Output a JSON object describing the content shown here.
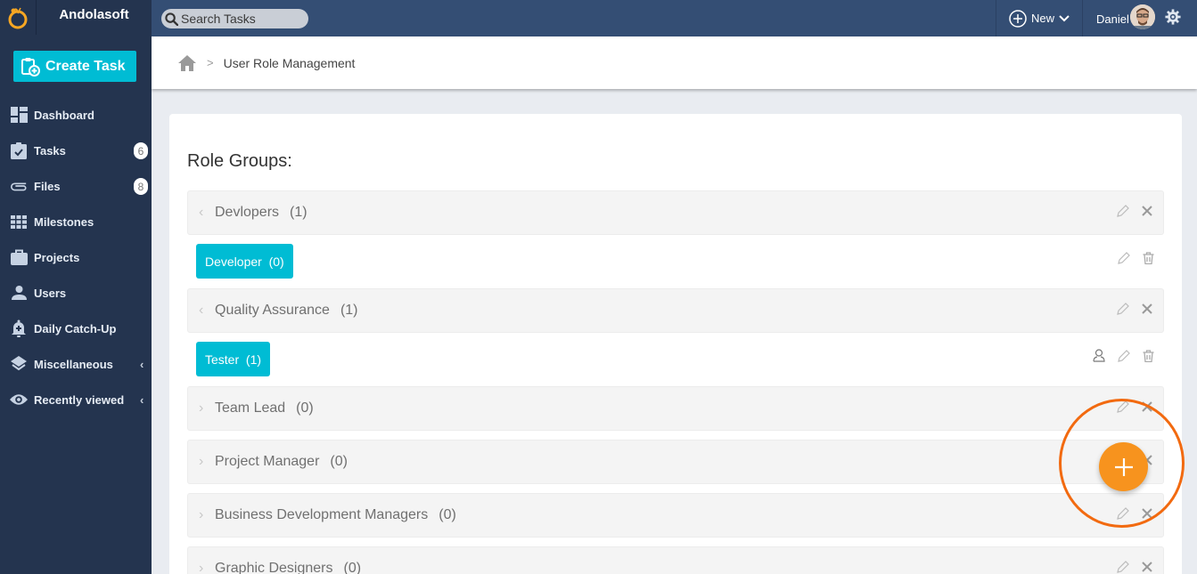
{
  "app": {
    "brand_name": "Andolasoft",
    "search_placeholder": "Search Tasks",
    "new_label": "New",
    "user_name": "Daniel"
  },
  "sidebar": {
    "create_task_label": "Create Task",
    "items": [
      {
        "label": "Dashboard",
        "icon": "dashboard-icon"
      },
      {
        "label": "Tasks",
        "icon": "tasks-icon",
        "badge": "6"
      },
      {
        "label": "Files",
        "icon": "paperclip-icon",
        "badge": "8"
      },
      {
        "label": "Milestones",
        "icon": "grid-icon"
      },
      {
        "label": "Projects",
        "icon": "briefcase-icon"
      },
      {
        "label": "Users",
        "icon": "user-icon"
      },
      {
        "label": "Daily Catch-Up",
        "icon": "bell-plus-icon"
      },
      {
        "label": "Miscellaneous",
        "icon": "layers-icon",
        "chevron": "‹"
      },
      {
        "label": "Recently viewed",
        "icon": "eye-icon",
        "chevron": "‹"
      }
    ]
  },
  "breadcrumb": {
    "separator": ">",
    "current": "User Role Management"
  },
  "main": {
    "title": "Role Groups:",
    "groups": [
      {
        "name": "Devlopers",
        "count": "(1)",
        "expanded": true,
        "roles": [
          {
            "name": "Developer",
            "count": "(0)",
            "has_user_icon": false
          }
        ]
      },
      {
        "name": "Quality Assurance",
        "count": "(1)",
        "expanded": true,
        "roles": [
          {
            "name": "Tester",
            "count": "(1)",
            "has_user_icon": true
          }
        ]
      },
      {
        "name": "Team Lead",
        "count": "(0)",
        "expanded": false
      },
      {
        "name": "Project Manager",
        "count": "(0)",
        "expanded": false
      },
      {
        "name": "Business Development Managers",
        "count": "(0)",
        "expanded": false
      },
      {
        "name": "Graphic Designers",
        "count": "(0)",
        "expanded": false
      }
    ]
  },
  "colors": {
    "accent": "#00bcd4",
    "fab": "#f7931e",
    "highlight": "#f26a10",
    "topbar": "#344e74",
    "sidebar": "#24344f"
  }
}
